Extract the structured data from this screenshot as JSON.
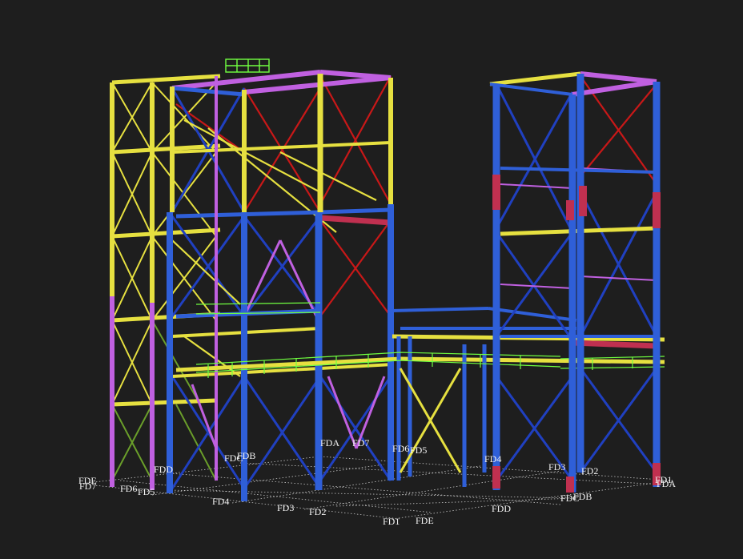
{
  "colors": {
    "background": "#1e1e1e",
    "column_blue": "#2f5fd8",
    "beam_yellow": "#e6e040",
    "beam_magenta": "#c060e0",
    "brace_red": "#c81818",
    "brace_blue": "#2040c0",
    "handrail_green": "#70ff40",
    "grid_line": "#c8c8c8",
    "label": "#f2f2f2"
  },
  "grid_labels": [
    {
      "id": "fde-left",
      "text": "FDE"
    },
    {
      "id": "fd7-left",
      "text": "FD7"
    },
    {
      "id": "fd6-left",
      "text": "FD6"
    },
    {
      "id": "fd5-left",
      "text": "FD5"
    },
    {
      "id": "fdd-left",
      "text": "FDD"
    },
    {
      "id": "fdc-upper",
      "text": "FDC"
    },
    {
      "id": "fdb-upper",
      "text": "FDB"
    },
    {
      "id": "fd4-left",
      "text": "FD4"
    },
    {
      "id": "fd3-left",
      "text": "FD3"
    },
    {
      "id": "fd2-left",
      "text": "FD2"
    },
    {
      "id": "fda-mid",
      "text": "FDA"
    },
    {
      "id": "fd7-mid",
      "text": "FD7"
    },
    {
      "id": "fd6-mid",
      "text": "FD6"
    },
    {
      "id": "fd5-mid",
      "text": "FD5"
    },
    {
      "id": "fd1-bottom",
      "text": "FD1"
    },
    {
      "id": "fde-bottom",
      "text": "FDE"
    },
    {
      "id": "fd4-right",
      "text": "FD4"
    },
    {
      "id": "fdd-right",
      "text": "FDD"
    },
    {
      "id": "fd3-right",
      "text": "FD3"
    },
    {
      "id": "fd2-right",
      "text": "FD2"
    },
    {
      "id": "fdc-right",
      "text": "FDC"
    },
    {
      "id": "fdb-right",
      "text": "FDB"
    },
    {
      "id": "fd1-right",
      "text": "FD1"
    },
    {
      "id": "fda-right",
      "text": "FDA"
    }
  ]
}
